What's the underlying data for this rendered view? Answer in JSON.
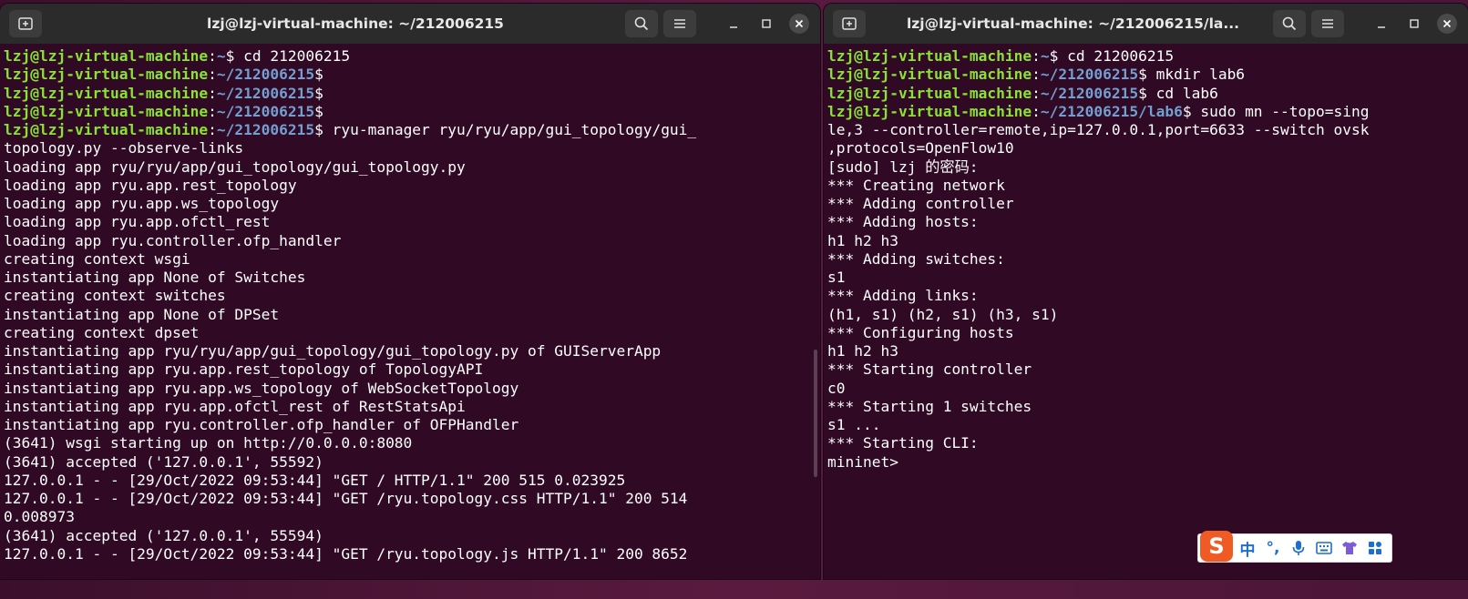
{
  "left_terminal": {
    "title": "lzj@lzj-virtual-machine: ~/212006215",
    "lines": [
      [
        {
          "c": "u",
          "t": "lzj@lzj-virtual-machine"
        },
        {
          "c": "w",
          "t": ":"
        },
        {
          "c": "p",
          "t": "~"
        },
        {
          "c": "w",
          "t": "$ cd 212006215"
        }
      ],
      [
        {
          "c": "u",
          "t": "lzj@lzj-virtual-machine"
        },
        {
          "c": "w",
          "t": ":"
        },
        {
          "c": "p",
          "t": "~/212006215"
        },
        {
          "c": "w",
          "t": "$"
        }
      ],
      [
        {
          "c": "u",
          "t": "lzj@lzj-virtual-machine"
        },
        {
          "c": "w",
          "t": ":"
        },
        {
          "c": "p",
          "t": "~/212006215"
        },
        {
          "c": "w",
          "t": "$"
        }
      ],
      [
        {
          "c": "u",
          "t": "lzj@lzj-virtual-machine"
        },
        {
          "c": "w",
          "t": ":"
        },
        {
          "c": "p",
          "t": "~/212006215"
        },
        {
          "c": "w",
          "t": "$"
        }
      ],
      [
        {
          "c": "u",
          "t": "lzj@lzj-virtual-machine"
        },
        {
          "c": "w",
          "t": ":"
        },
        {
          "c": "p",
          "t": "~/212006215"
        },
        {
          "c": "w",
          "t": "$ ryu-manager ryu/ryu/app/gui_topology/gui_"
        }
      ],
      [
        {
          "c": "w",
          "t": "topology.py --observe-links"
        }
      ],
      [
        {
          "c": "w",
          "t": "loading app ryu/ryu/app/gui_topology/gui_topology.py"
        }
      ],
      [
        {
          "c": "w",
          "t": "loading app ryu.app.rest_topology"
        }
      ],
      [
        {
          "c": "w",
          "t": "loading app ryu.app.ws_topology"
        }
      ],
      [
        {
          "c": "w",
          "t": "loading app ryu.app.ofctl_rest"
        }
      ],
      [
        {
          "c": "w",
          "t": "loading app ryu.controller.ofp_handler"
        }
      ],
      [
        {
          "c": "w",
          "t": "creating context wsgi"
        }
      ],
      [
        {
          "c": "w",
          "t": "instantiating app None of Switches"
        }
      ],
      [
        {
          "c": "w",
          "t": "creating context switches"
        }
      ],
      [
        {
          "c": "w",
          "t": "instantiating app None of DPSet"
        }
      ],
      [
        {
          "c": "w",
          "t": "creating context dpset"
        }
      ],
      [
        {
          "c": "w",
          "t": "instantiating app ryu/ryu/app/gui_topology/gui_topology.py of GUIServerApp"
        }
      ],
      [
        {
          "c": "w",
          "t": "instantiating app ryu.app.rest_topology of TopologyAPI"
        }
      ],
      [
        {
          "c": "w",
          "t": "instantiating app ryu.app.ws_topology of WebSocketTopology"
        }
      ],
      [
        {
          "c": "w",
          "t": "instantiating app ryu.app.ofctl_rest of RestStatsApi"
        }
      ],
      [
        {
          "c": "w",
          "t": "instantiating app ryu.controller.ofp_handler of OFPHandler"
        }
      ],
      [
        {
          "c": "w",
          "t": "(3641) wsgi starting up on http://0.0.0.0:8080"
        }
      ],
      [
        {
          "c": "w",
          "t": "(3641) accepted ('127.0.0.1', 55592)"
        }
      ],
      [
        {
          "c": "w",
          "t": "127.0.0.1 - - [29/Oct/2022 09:53:44] \"GET / HTTP/1.1\" 200 515 0.023925"
        }
      ],
      [
        {
          "c": "w",
          "t": "127.0.0.1 - - [29/Oct/2022 09:53:44] \"GET /ryu.topology.css HTTP/1.1\" 200 514"
        }
      ],
      [
        {
          "c": "w",
          "t": "0.008973"
        }
      ],
      [
        {
          "c": "w",
          "t": "(3641) accepted ('127.0.0.1', 55594)"
        }
      ],
      [
        {
          "c": "w",
          "t": "127.0.0.1 - - [29/Oct/2022 09:53:44] \"GET /ryu.topology.js HTTP/1.1\" 200 8652"
        }
      ]
    ]
  },
  "right_terminal": {
    "title": "lzj@lzj-virtual-machine: ~/212006215/la...",
    "lines": [
      [
        {
          "c": "u",
          "t": "lzj@lzj-virtual-machine"
        },
        {
          "c": "w",
          "t": ":"
        },
        {
          "c": "p",
          "t": "~"
        },
        {
          "c": "w",
          "t": "$ cd 212006215"
        }
      ],
      [
        {
          "c": "u",
          "t": "lzj@lzj-virtual-machine"
        },
        {
          "c": "w",
          "t": ":"
        },
        {
          "c": "p",
          "t": "~/212006215"
        },
        {
          "c": "w",
          "t": "$ mkdir lab6"
        }
      ],
      [
        {
          "c": "u",
          "t": "lzj@lzj-virtual-machine"
        },
        {
          "c": "w",
          "t": ":"
        },
        {
          "c": "p",
          "t": "~/212006215"
        },
        {
          "c": "w",
          "t": "$ cd lab6"
        }
      ],
      [
        {
          "c": "u",
          "t": "lzj@lzj-virtual-machine"
        },
        {
          "c": "w",
          "t": ":"
        },
        {
          "c": "p",
          "t": "~/212006215/lab6"
        },
        {
          "c": "w",
          "t": "$ sudo mn --topo=sing"
        }
      ],
      [
        {
          "c": "w",
          "t": "le,3 --controller=remote,ip=127.0.0.1,port=6633 --switch ovsk"
        }
      ],
      [
        {
          "c": "w",
          "t": ",protocols=OpenFlow10"
        }
      ],
      [
        {
          "c": "w",
          "t": "[sudo] lzj 的密码:"
        }
      ],
      [
        {
          "c": "w",
          "t": "*** Creating network"
        }
      ],
      [
        {
          "c": "w",
          "t": "*** Adding controller"
        }
      ],
      [
        {
          "c": "w",
          "t": "*** Adding hosts:"
        }
      ],
      [
        {
          "c": "w",
          "t": "h1 h2 h3"
        }
      ],
      [
        {
          "c": "w",
          "t": "*** Adding switches:"
        }
      ],
      [
        {
          "c": "w",
          "t": "s1"
        }
      ],
      [
        {
          "c": "w",
          "t": "*** Adding links:"
        }
      ],
      [
        {
          "c": "w",
          "t": "(h1, s1) (h2, s1) (h3, s1)"
        }
      ],
      [
        {
          "c": "w",
          "t": "*** Configuring hosts"
        }
      ],
      [
        {
          "c": "w",
          "t": "h1 h2 h3"
        }
      ],
      [
        {
          "c": "w",
          "t": "*** Starting controller"
        }
      ],
      [
        {
          "c": "w",
          "t": "c0"
        }
      ],
      [
        {
          "c": "w",
          "t": "*** Starting 1 switches"
        }
      ],
      [
        {
          "c": "w",
          "t": "s1 ..."
        }
      ],
      [
        {
          "c": "w",
          "t": "*** Starting CLI:"
        }
      ],
      [
        {
          "c": "w",
          "t": "mininet> "
        }
      ]
    ]
  },
  "icons": {
    "new_tab": "new-tab-icon",
    "search": "search-icon",
    "menu": "hamburger-menu-icon",
    "minimize": "minimize-icon",
    "maximize": "maximize-icon",
    "close": "close-icon"
  },
  "ime_toolbar": {
    "logo": "S",
    "mode": "中",
    "punct": "°,"
  },
  "colors": {
    "terminal_bg": "#300a24",
    "user_host": "#8ae234",
    "path": "#729fcf",
    "titlebar": "#2b2b2b",
    "ime_logo": "#f05a24"
  }
}
